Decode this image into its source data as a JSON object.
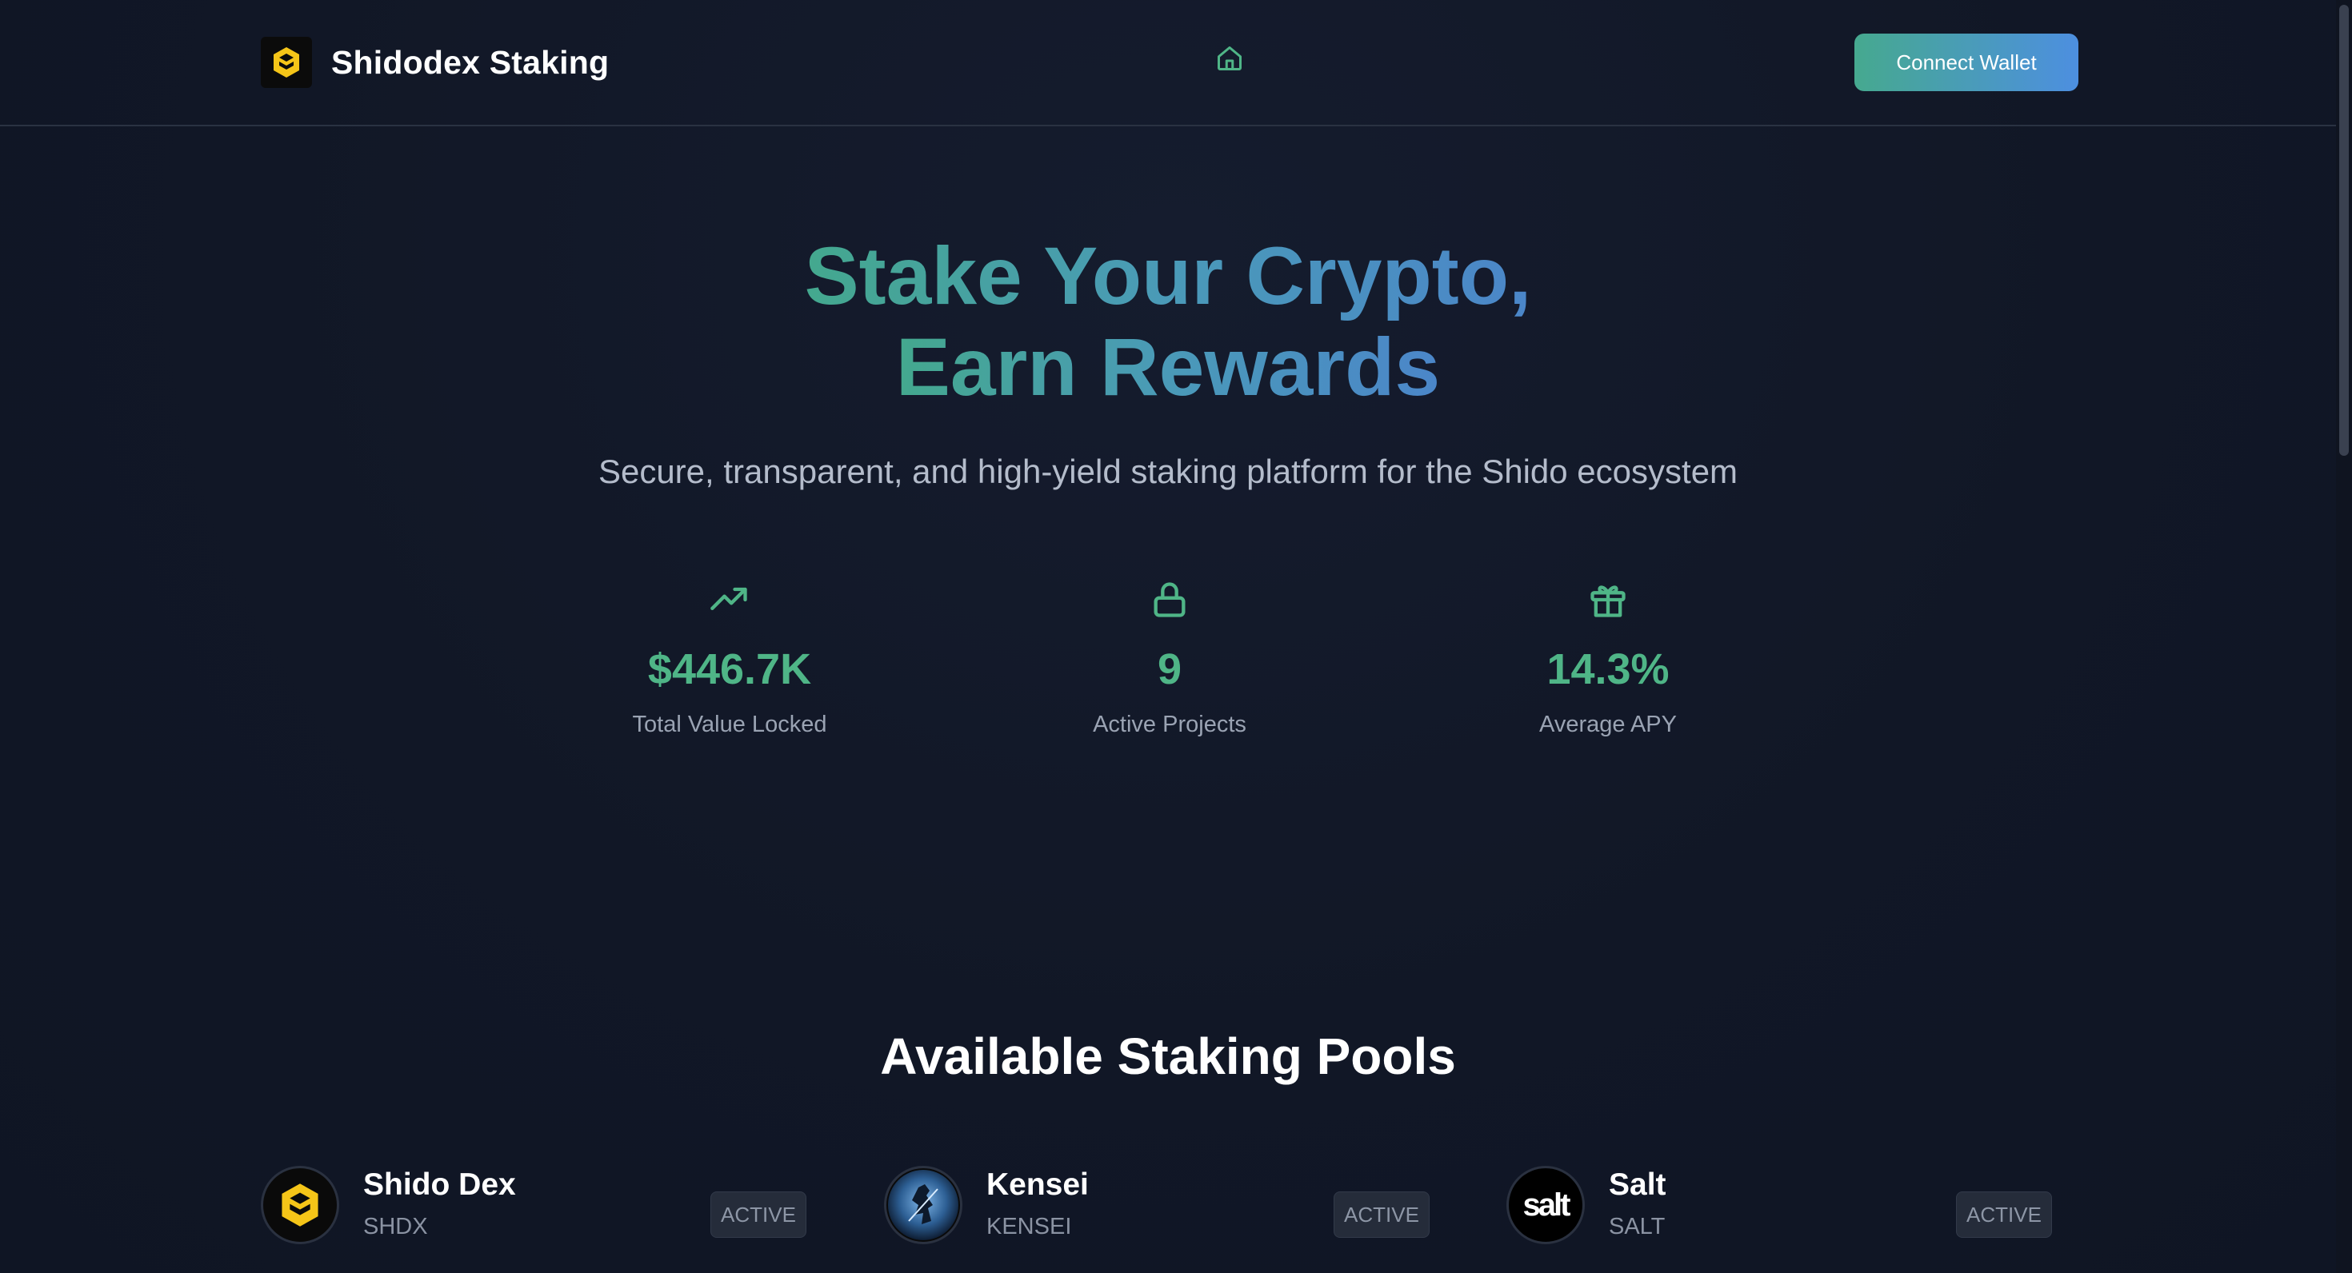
{
  "header": {
    "brand_name": "Shidodex Staking",
    "connect_wallet_label": "Connect Wallet"
  },
  "hero": {
    "title_line1": "Stake Your Crypto,",
    "title_line2": "Earn Rewards",
    "subtitle": "Secure, transparent, and high-yield staking platform for the Shido ecosystem"
  },
  "stats": [
    {
      "icon": "trending-up-icon",
      "value": "$446.7K",
      "label": "Total Value Locked"
    },
    {
      "icon": "lock-icon",
      "value": "9",
      "label": "Active Projects"
    },
    {
      "icon": "gift-icon",
      "value": "14.3%",
      "label": "Average APY"
    }
  ],
  "pools_section": {
    "title": "Available Staking Pools",
    "pools": [
      {
        "name": "Shido Dex",
        "symbol": "SHDX",
        "status": "ACTIVE"
      },
      {
        "name": "Kensei",
        "symbol": "KENSEI",
        "status": "ACTIVE"
      },
      {
        "name": "Salt",
        "symbol": "SALT",
        "status": "ACTIVE",
        "logo_text": "salt"
      }
    ]
  },
  "colors": {
    "background": "#111726",
    "accent_green": "#4fb587",
    "accent_blue": "#4d8fe0",
    "brand_yellow": "#f5c518"
  }
}
